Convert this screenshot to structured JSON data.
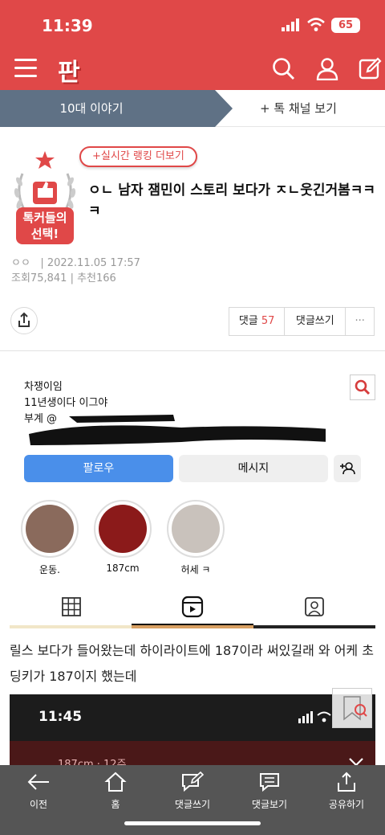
{
  "status_bar": {
    "time": "11:39",
    "battery": "65"
  },
  "header": {
    "logo": "판",
    "icons": [
      "hamburger-icon",
      "search-icon",
      "user-icon",
      "edit-icon"
    ]
  },
  "tabs": {
    "active": "10대 이야기",
    "other": "+ 톡 채널 보기"
  },
  "post": {
    "badge_line1": "톡커들의",
    "badge_line2": "선택!",
    "ranking_link": "+실시간 랭킹 더보기",
    "title": "ㅇㄴ 남자 잼민이 스토리 보다가 ㅈㄴ웃긴거봄ㅋㅋㅋ",
    "author": "ㅇㅇ",
    "date": "| 2022.11.05 17:57",
    "views_label": "조회",
    "views": "75,841",
    "recommend_label": "| 추천",
    "recommend": "166"
  },
  "actions": {
    "comments_label": "댓글",
    "comments_count": "57",
    "write_comment": "댓글쓰기",
    "more": "···"
  },
  "instagram": {
    "line1": "차쟁이임",
    "line2": "11년생이다 이그야",
    "line3": "부계 @",
    "follow": "팔로우",
    "message": "메시지",
    "highlights": [
      {
        "label": "운동."
      },
      {
        "label": "187cm"
      },
      {
        "label": "허세 ㅋ"
      }
    ]
  },
  "body": {
    "text": "릴스 보다가 들어왔는데 하이라이트에 187이라 써있길래 와 어케 초딩키가 187이지 했는데"
  },
  "screenshot2": {
    "time": "11:45",
    "caption": "187cm · 12주"
  },
  "bottom_nav": [
    {
      "label": "이전"
    },
    {
      "label": "홈"
    },
    {
      "label": "댓글쓰기"
    },
    {
      "label": "댓글보기"
    },
    {
      "label": "공유하기"
    }
  ],
  "colors": {
    "brand": "#e04848",
    "tab_active": "#5f7185",
    "follow": "#4a8fea",
    "bottom_nav": "#555555"
  }
}
